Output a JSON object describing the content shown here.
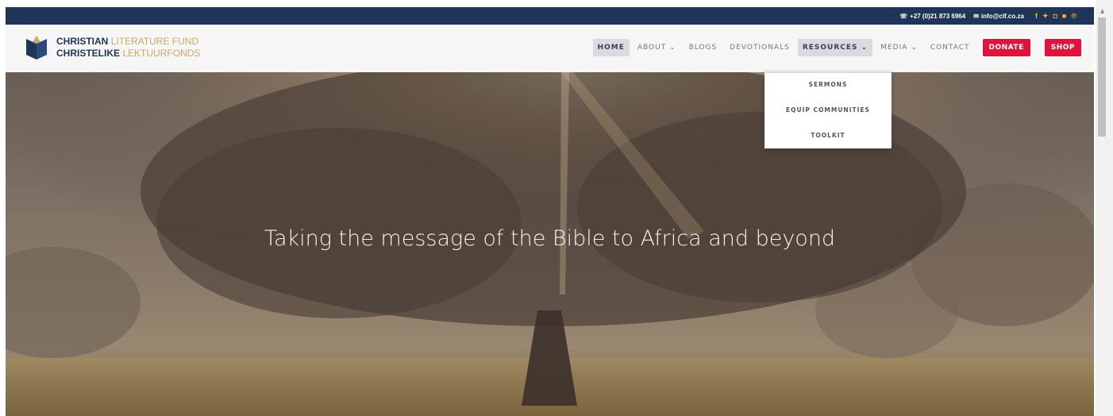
{
  "topbar": {
    "phone": "+27 (0)21 873 6964",
    "email": "info@clf.co.za",
    "social": [
      "f",
      "t",
      "ig",
      "yt",
      "p"
    ]
  },
  "logo": {
    "line1_dark": "CHRISTIAN",
    "line1_gold": "LITERATURE FUND",
    "line2_dark": "CHRISTELIKE",
    "line2_gold": "LEKTUURFONDS"
  },
  "nav": {
    "home": "HOME",
    "about": "ABOUT",
    "blogs": "BLOGS",
    "devotionals": "DEVOTIONALS",
    "resources": "RESOURCES",
    "media": "MEDIA",
    "contact": "CONTACT",
    "donate": "DONATE",
    "shop": "SHOP",
    "chevron": "⌄"
  },
  "dropdown": {
    "items": [
      "SERMONS",
      "EQUIP COMMUNITIES",
      "TOOLKIT"
    ]
  },
  "hero": {
    "tagline": "Taking the message of the Bible to Africa and beyond"
  },
  "colors": {
    "topbar": "#1f3558",
    "accent_red": "#e2123d",
    "gold": "#c9a86a"
  }
}
